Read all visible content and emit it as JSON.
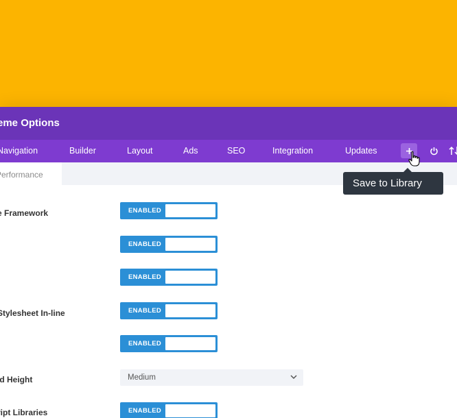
{
  "header": {
    "title": "eme Options"
  },
  "nav": {
    "items": [
      "Navigation",
      "Builder",
      "Layout",
      "Ads",
      "SEO",
      "Integration",
      "Updates"
    ],
    "add_icon": "plus-icon",
    "power_icon": "power-icon",
    "sort_icon": "sort-arrows-icon"
  },
  "subtabs": {
    "active": "Performance"
  },
  "settings": {
    "rows": [
      {
        "label": "e Framework",
        "toggle": "ENABLED"
      },
      {
        "label": "",
        "toggle": "ENABLED"
      },
      {
        "label": "",
        "toggle": "ENABLED"
      },
      {
        "label": "Stylesheet In-line",
        "toggle": "ENABLED"
      },
      {
        "label": "",
        "toggle": "ENABLED"
      },
      {
        "label": "ld Height",
        "select_value": "Medium"
      },
      {
        "label": "ript Libraries",
        "toggle": "ENABLED"
      }
    ]
  },
  "tooltip": {
    "text": "Save to Library"
  },
  "colors": {
    "hero": "#fcb400",
    "titlebar": "#6b34b8",
    "navbar": "#7e3bd0",
    "toggle": "#2b8fd6",
    "tooltip": "#2e3640"
  }
}
